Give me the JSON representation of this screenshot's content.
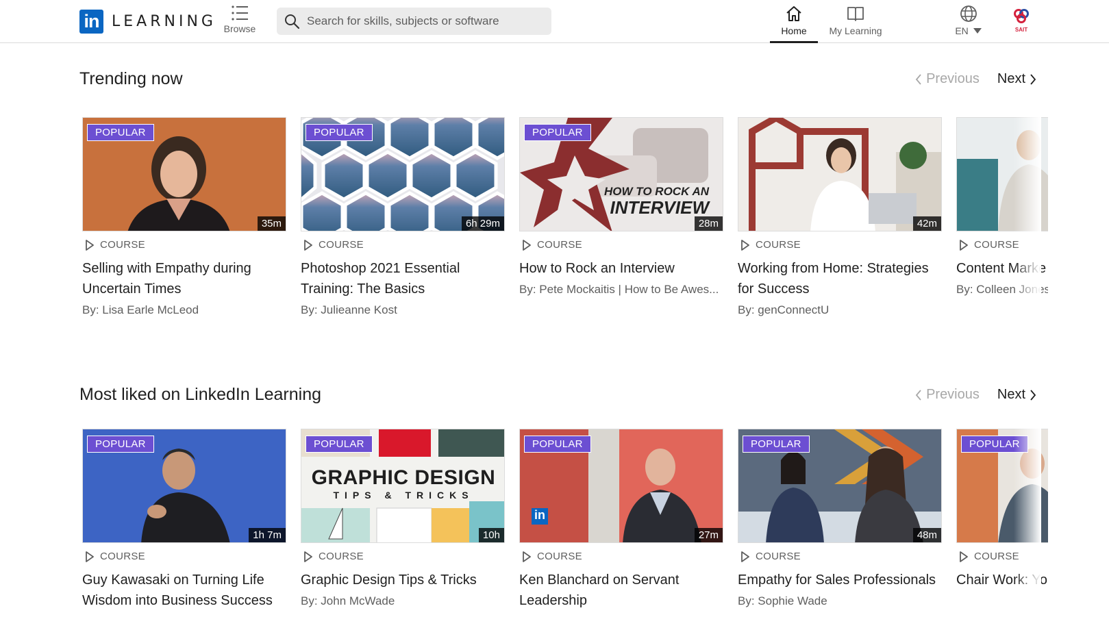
{
  "header": {
    "logo_letters": "in",
    "logo_text": "LEARNING",
    "browse_label": "Browse",
    "search_placeholder": "Search for skills, subjects or software",
    "nav": {
      "home": "Home",
      "my_learning": "My Learning",
      "language": "EN"
    },
    "org_logo_text": "SAIT"
  },
  "colors": {
    "badge": "#6c4fd2",
    "brand": "#0a66c2",
    "org": "#d4213d"
  },
  "sections": [
    {
      "title": "Trending now",
      "prev_label": "Previous",
      "next_label": "Next",
      "cards": [
        {
          "badge": "POPULAR",
          "duration": "35m",
          "type": "COURSE",
          "title": "Selling with Empathy during Uncertain Times",
          "author": "By: Lisa Earle McLeod"
        },
        {
          "badge": "POPULAR",
          "duration": "6h 29m",
          "type": "COURSE",
          "title": "Photoshop 2021 Essential Training: The Basics",
          "author": "By: Julieanne Kost"
        },
        {
          "badge": "POPULAR",
          "duration": "28m",
          "type": "COURSE",
          "title": "How to Rock an Interview",
          "author": "By: Pete Mockaitis | How to Be Awes...",
          "thumb_text_1": "HOW TO ROCK AN",
          "thumb_text_2": "INTERVIEW"
        },
        {
          "badge": "",
          "duration": "42m",
          "type": "COURSE",
          "title": "Working from Home: Strategies for Success",
          "author": "By: genConnectU"
        },
        {
          "badge": "",
          "duration": "",
          "type": "COURSE",
          "title": "Content Marke Media",
          "author": "By: Colleen Jones"
        }
      ]
    },
    {
      "title": "Most liked on LinkedIn Learning",
      "prev_label": "Previous",
      "next_label": "Next",
      "cards": [
        {
          "badge": "POPULAR",
          "duration": "1h 7m",
          "type": "COURSE",
          "title": "Guy Kawasaki on Turning Life Wisdom into Business Success",
          "author": ""
        },
        {
          "badge": "POPULAR",
          "duration": "10h",
          "type": "COURSE",
          "title": "Graphic Design Tips & Tricks",
          "author": "By: John McWade",
          "thumb_text_1": "GRAPHIC DESIGN",
          "thumb_text_2": "TIPS & TRICKS"
        },
        {
          "badge": "POPULAR",
          "duration": "27m",
          "type": "COURSE",
          "title": "Ken Blanchard on Servant Leadership",
          "author": ""
        },
        {
          "badge": "POPULAR",
          "duration": "48m",
          "type": "COURSE",
          "title": "Empathy for Sales Professionals",
          "author": "By: Sophie Wade"
        },
        {
          "badge": "POPULAR",
          "duration": "",
          "type": "COURSE",
          "title": "Chair Work: Yo Stretching at Y",
          "author": ""
        }
      ]
    }
  ]
}
